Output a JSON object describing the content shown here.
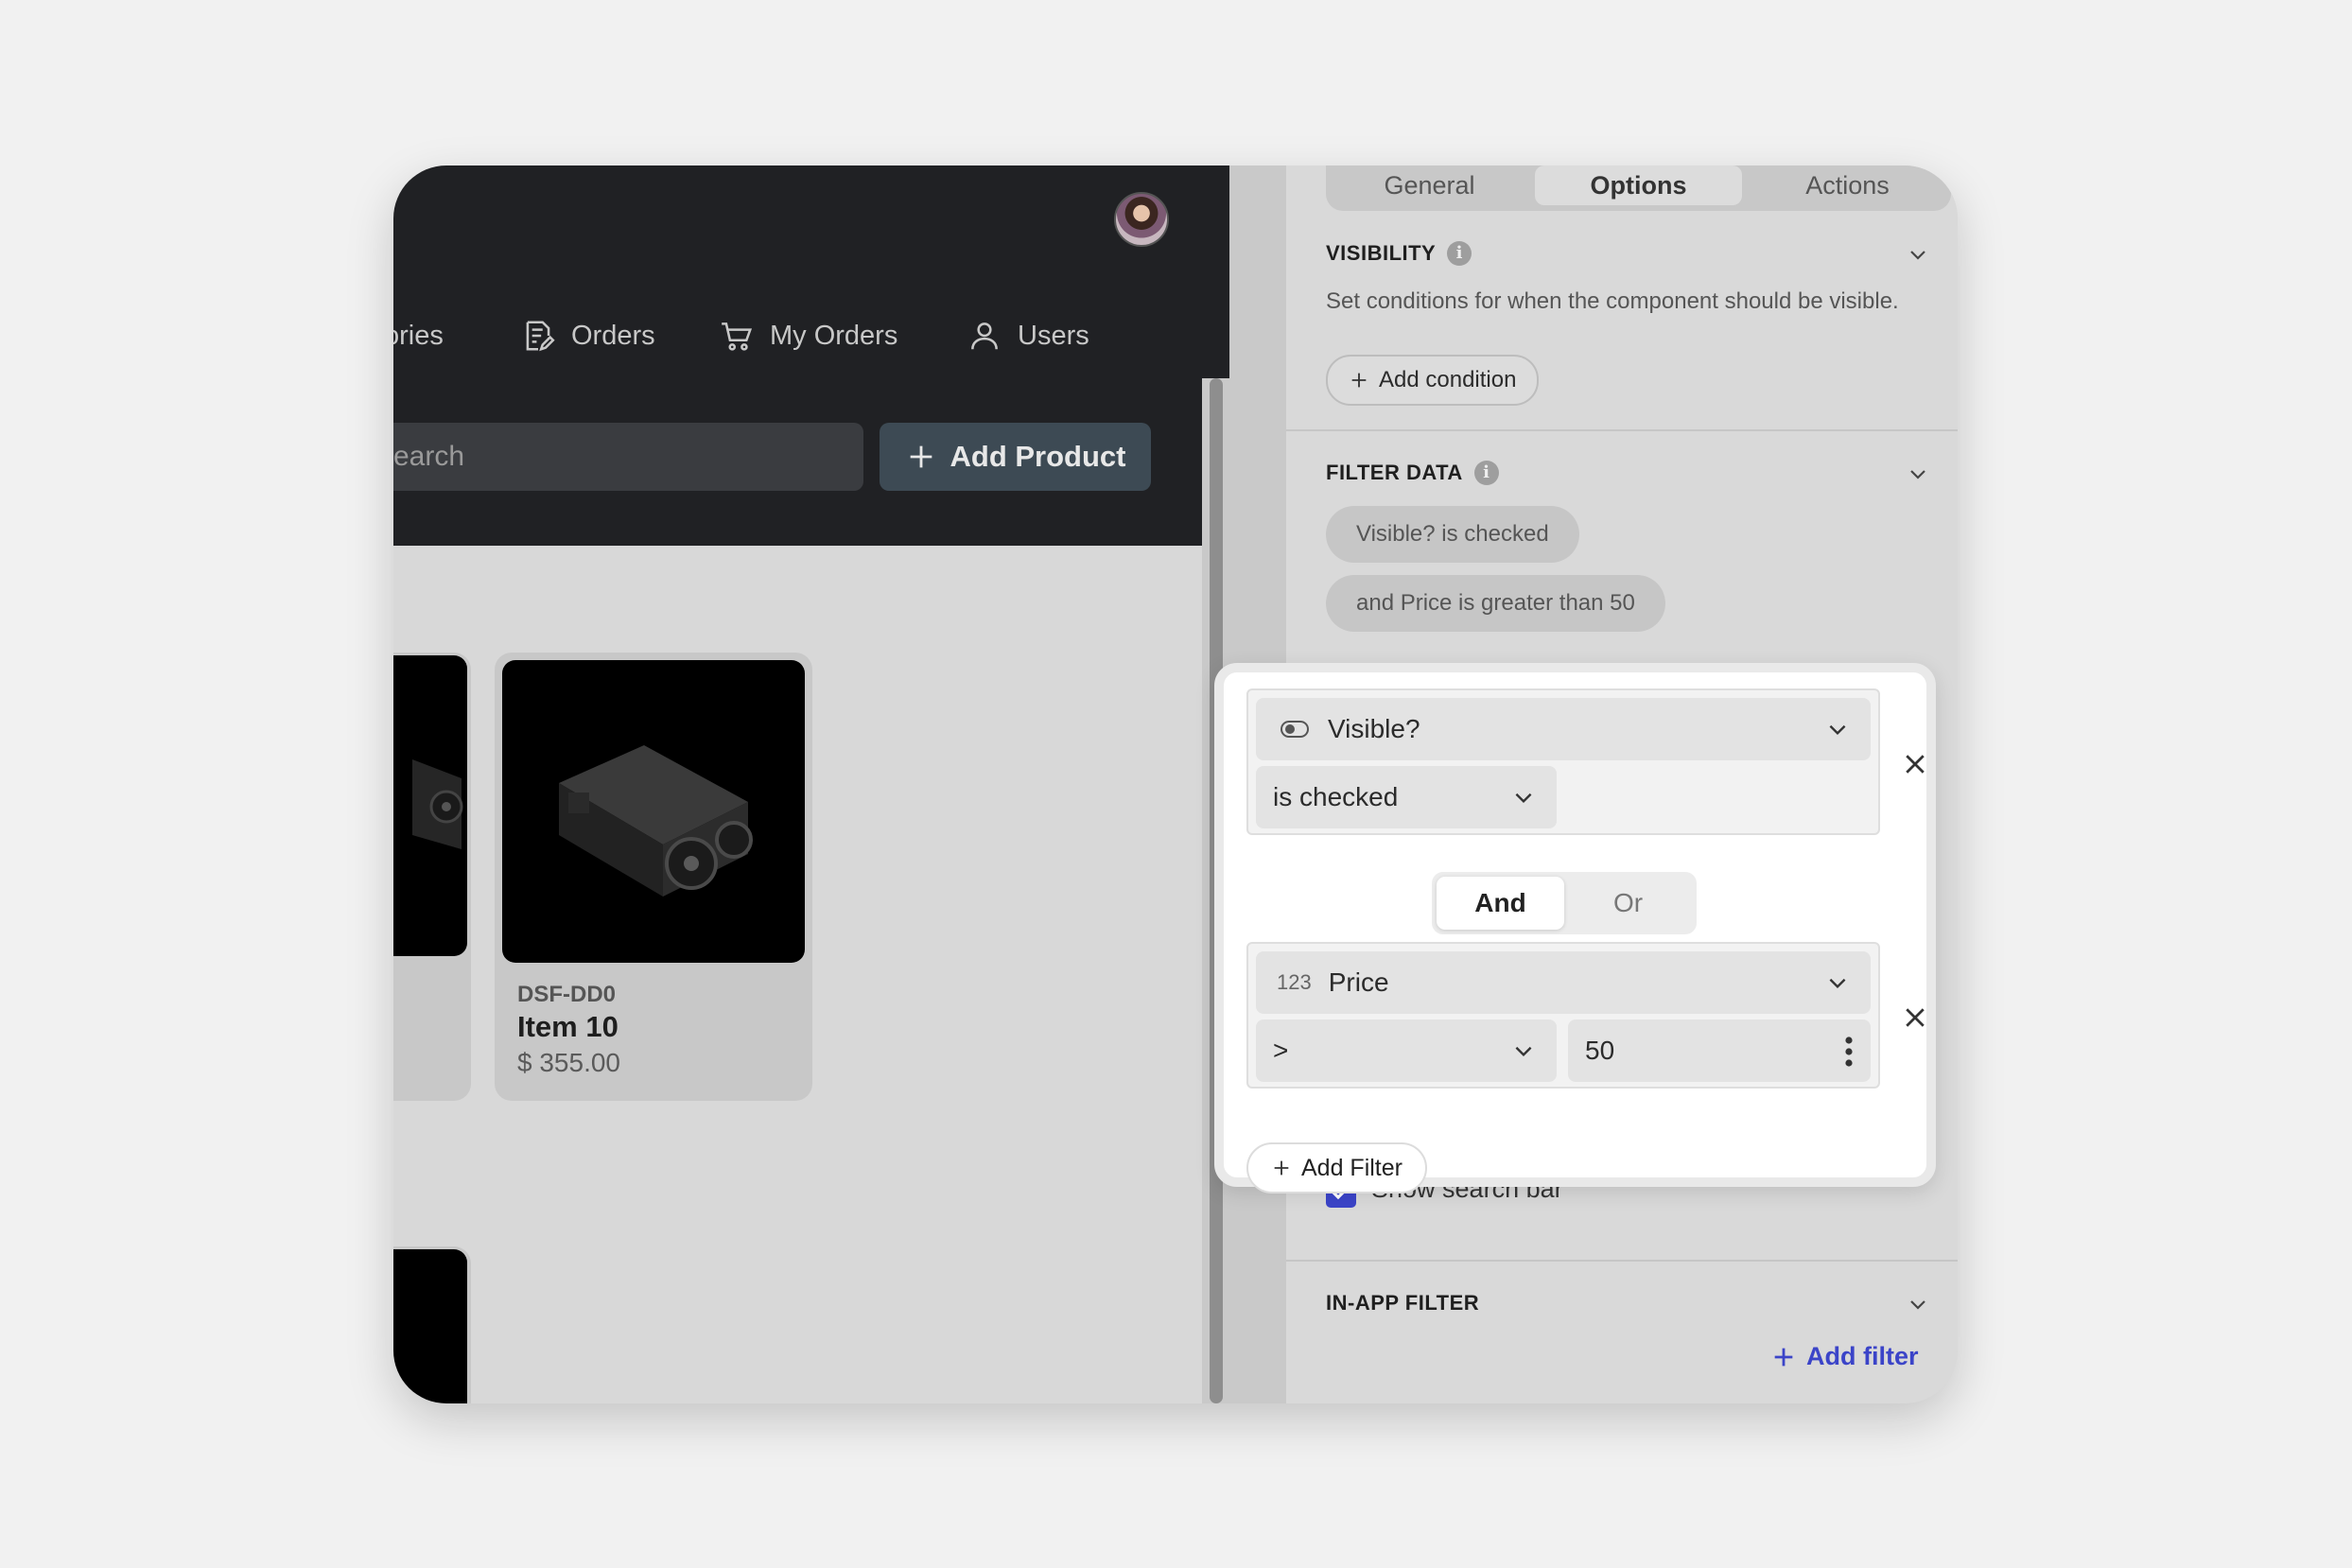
{
  "app": {
    "nav": [
      {
        "label": "ories",
        "icon": "tag-icon"
      },
      {
        "label": "Orders",
        "icon": "document-edit-icon"
      },
      {
        "label": "My Orders",
        "icon": "cart-icon"
      },
      {
        "label": "Users",
        "icon": "user-icon"
      }
    ],
    "search_placeholder": "earch",
    "add_product_label": "Add Product",
    "product": {
      "sku": "DSF-DD0",
      "name": "Item 10",
      "price": "$ 355.00"
    }
  },
  "panel": {
    "tabs": [
      {
        "label": "General",
        "active": false
      },
      {
        "label": "Options",
        "active": true
      },
      {
        "label": "Actions",
        "active": false
      }
    ],
    "visibility": {
      "title": "VISIBILITY",
      "description": "Set conditions for when the component should be visible.",
      "add_condition_label": "Add condition"
    },
    "filter_data": {
      "title": "FILTER DATA",
      "chips": [
        "Visible? is checked",
        "and Price is greater than 50"
      ]
    },
    "show_search_bar": {
      "label": "Show search bar",
      "checked": true
    },
    "in_app_filter": {
      "title": "IN-APP FILTER",
      "add_filter_label": "Add filter"
    }
  },
  "popover": {
    "condition1": {
      "field": "Visible?",
      "field_icon": "toggle-icon",
      "operator": "is checked"
    },
    "connector": {
      "options": [
        "And",
        "Or"
      ],
      "selected": "And"
    },
    "condition2": {
      "field_icon_text": "123",
      "field": "Price",
      "operator": ">",
      "value": "50"
    },
    "add_filter_label": "Add Filter"
  },
  "colors": {
    "accent": "#3b44c8",
    "header_bg": "#202124",
    "button_bg": "#3d4a54"
  }
}
